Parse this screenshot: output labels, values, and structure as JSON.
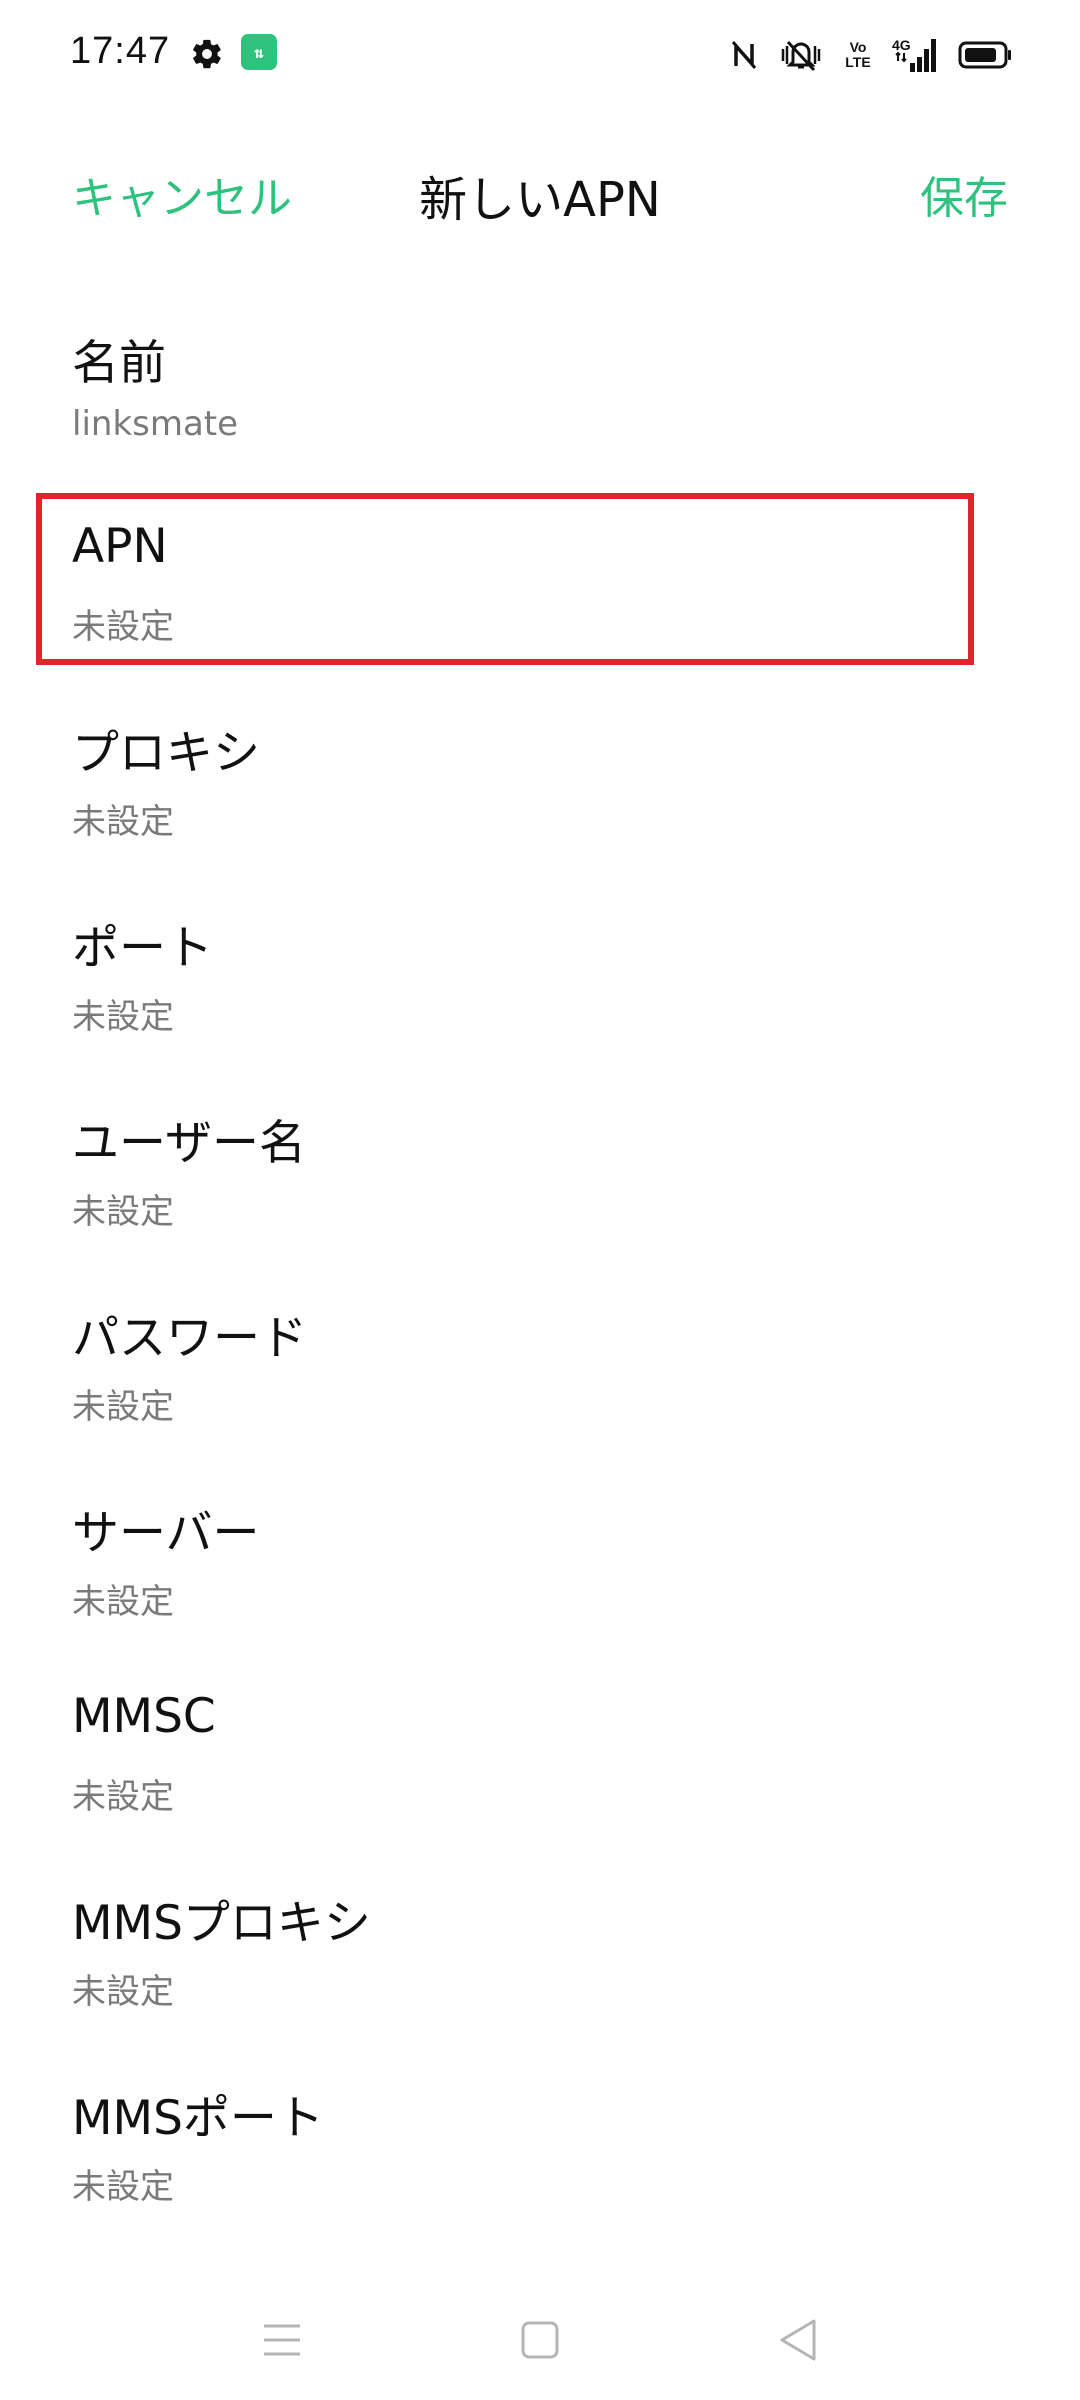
{
  "status_bar": {
    "time": "17:47",
    "icons": [
      "settings-gear-icon",
      "data-transfer-app-icon",
      "nfc-icon",
      "vibrate-mute-icon",
      "volte-icon",
      "4g-signal-icon",
      "battery-icon"
    ],
    "volte_label": "Vo\nLTE",
    "network_label": "4G"
  },
  "app_bar": {
    "cancel_label": "キャンセル",
    "title": "新しいAPN",
    "save_label": "保存",
    "accent_color": "#2ec27e"
  },
  "items": [
    {
      "label": "名前",
      "value": "linksmate"
    },
    {
      "label": "APN",
      "value": "未設定"
    },
    {
      "label": "プロキシ",
      "value": "未設定"
    },
    {
      "label": "ポート",
      "value": "未設定"
    },
    {
      "label": "ユーザー名",
      "value": "未設定"
    },
    {
      "label": "パスワード",
      "value": "未設定"
    },
    {
      "label": "サーバー",
      "value": "未設定"
    },
    {
      "label": "MMSC",
      "value": "未設定"
    },
    {
      "label": "MMSプロキシ",
      "value": "未設定"
    },
    {
      "label": "MMSポート",
      "value": "未設定"
    }
  ],
  "highlight": {
    "color": "#e3232b",
    "target": "APN"
  },
  "nav_bar": {
    "icons": [
      "menu-icon",
      "home-icon",
      "back-icon"
    ]
  }
}
